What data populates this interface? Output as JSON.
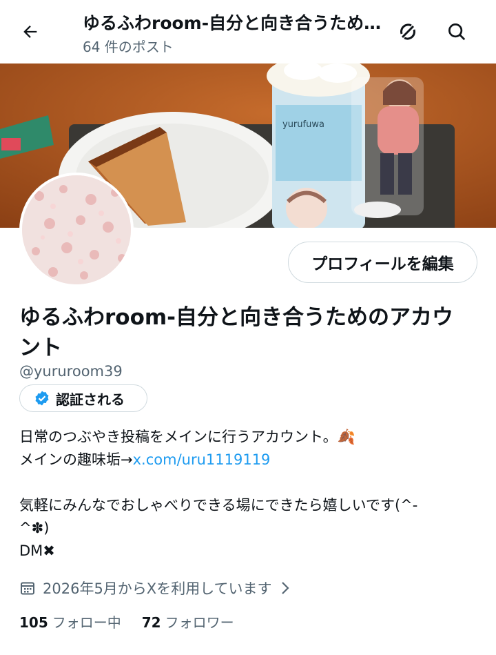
{
  "header": {
    "title": "ゆるふわroom-自分と向き合うためのアカウント",
    "post_count": "64 件のポスト"
  },
  "banner": {
    "cup_label": "yurufuwa"
  },
  "profile": {
    "edit_button": "プロフィールを編集",
    "display_name": "ゆるふわroom-自分と向き合うためのアカウント",
    "handle": "@yururoom39",
    "verify_button": "認証される",
    "bio_line1": "日常のつぶやき投稿をメインに行うアカウント。🍂",
    "bio_line2_prefix": "メインの趣味垢→",
    "bio_link": "x.com/uru1119119",
    "bio_line3": "気軽にみんなでおしゃべりできる場にできたら嬉しいです(^-",
    "bio_line4": "^✽)",
    "bio_line5": "DM✖",
    "joined": "2026年5月からXを利用しています",
    "following_count": "105",
    "following_label": "フォロー中",
    "followers_count": "72",
    "followers_label": "フォロワー"
  },
  "colors": {
    "accent": "#1d9bf0",
    "secondary_text": "#536471",
    "border": "#cfd9de",
    "verified": "#1d9bf0"
  }
}
